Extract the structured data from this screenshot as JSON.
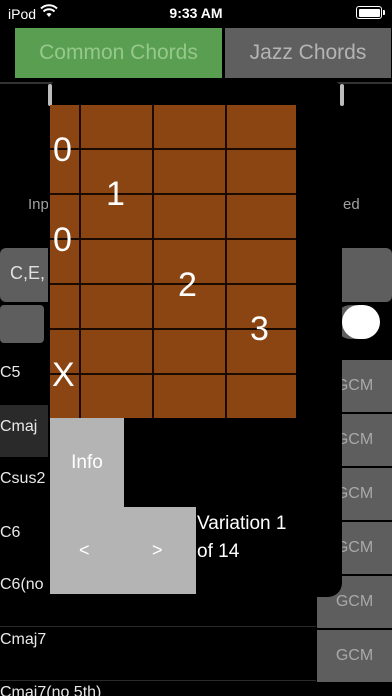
{
  "status": {
    "carrier": "iPod",
    "time": "9:33 AM"
  },
  "tabs": [
    {
      "label": "Common Chords",
      "active": true
    },
    {
      "label": "Jazz Chords",
      "active": false
    }
  ],
  "background": {
    "left_label": "Inp",
    "right_label": "ed",
    "input_value": "C,E,"
  },
  "chords": [
    {
      "name": "C5",
      "notes": "GCM"
    },
    {
      "name": "Cmaj",
      "notes": "GCM"
    },
    {
      "name": "Csus2",
      "notes": "GCM"
    },
    {
      "name": "C6",
      "notes": "GCM"
    },
    {
      "name": "C6(no",
      "notes": "GCM"
    },
    {
      "name": "Cmaj7",
      "notes": "GCM"
    },
    {
      "name": "Cmaj7(no 5th)",
      "notes": ""
    }
  ],
  "diagram": {
    "markers": [
      {
        "text": "0",
        "kind": "open-string"
      },
      {
        "text": "1",
        "kind": "finger"
      },
      {
        "text": "0",
        "kind": "open-string"
      },
      {
        "text": "2",
        "kind": "finger"
      },
      {
        "text": "3",
        "kind": "finger"
      },
      {
        "text": "X",
        "kind": "muted-string"
      }
    ]
  },
  "popup": {
    "info_label": "Info",
    "prev_label": "<",
    "next_label": ">",
    "variation_line1": "Variation 1",
    "variation_line2": "of 14"
  },
  "colors": {
    "active_tab": "#5a9e52",
    "inactive_tab": "#5f5f5f",
    "fretboard": "#8b4513",
    "info_panel": "#b4b4b4"
  }
}
